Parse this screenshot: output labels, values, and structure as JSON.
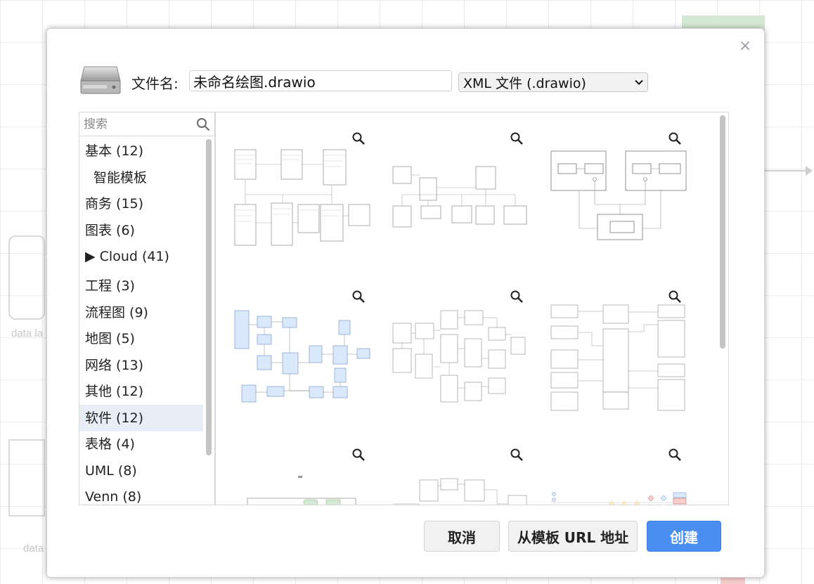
{
  "background": {
    "labels": [
      "data la",
      "data"
    ]
  },
  "dialog": {
    "close_glyph": "×",
    "filename_label": "文件名:",
    "filename_value": "未命名绘图.drawio",
    "format_selected": "XML 文件 (.drawio)",
    "search_placeholder": "搜索",
    "categories": [
      {
        "label": "基本 (12)"
      },
      {
        "label": "智能模板"
      },
      {
        "label": "商务 (15)"
      },
      {
        "label": "图表 (6)"
      },
      {
        "label": "▶ Cloud (41)"
      },
      {
        "label": "工程 (3)"
      },
      {
        "label": "流程图 (9)"
      },
      {
        "label": "地图 (5)"
      },
      {
        "label": "网络 (13)"
      },
      {
        "label": "其他 (12)"
      },
      {
        "label": "软件 (12)"
      },
      {
        "label": "表格 (4)"
      },
      {
        "label": "UML (8)"
      },
      {
        "label": "Venn (8)"
      }
    ],
    "selected_category": "软件 (12)",
    "buttons": {
      "cancel": "取消",
      "from_url": "从模板 URL 地址",
      "create": "创建"
    },
    "colors": {
      "accent": "#4b8ef1",
      "selected_bg": "#e8eef8",
      "thumb_blue": "#dae8fc"
    },
    "icons": [
      "close-icon",
      "drive-icon",
      "search-icon",
      "zoom-icon",
      "chevron-down-icon"
    ]
  }
}
